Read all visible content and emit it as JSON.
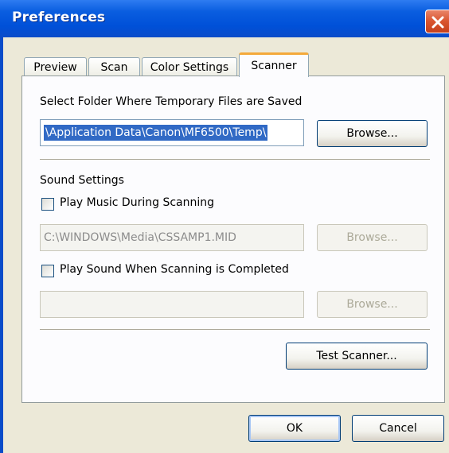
{
  "window": {
    "title": "Preferences"
  },
  "tabs": [
    {
      "label": "Preview",
      "active": false
    },
    {
      "label": "Scan",
      "active": false
    },
    {
      "label": "Color Settings",
      "active": false
    },
    {
      "label": "Scanner",
      "active": true
    }
  ],
  "temp_folder": {
    "label": "Select Folder Where Temporary Files are Saved",
    "path": "\\Application Data\\Canon\\MF6500\\Temp\\",
    "browse_label": "Browse..."
  },
  "sound": {
    "heading": "Sound Settings",
    "music_checkbox_label": "Play Music During Scanning",
    "music_checked": false,
    "music_path": "C:\\WINDOWS\\Media\\CSSAMP1.MID",
    "music_browse_label": "Browse...",
    "complete_checkbox_label": "Play Sound When Scanning is Completed",
    "complete_checked": false,
    "complete_path": "",
    "complete_browse_label": "Browse..."
  },
  "test_button_label": "Test Scanner...",
  "footer": {
    "ok_label": "OK",
    "cancel_label": "Cancel"
  },
  "colors": {
    "titlebar": "#0a5ee0",
    "selection": "#316ac5",
    "active_tab_accent": "#f4a93a"
  }
}
